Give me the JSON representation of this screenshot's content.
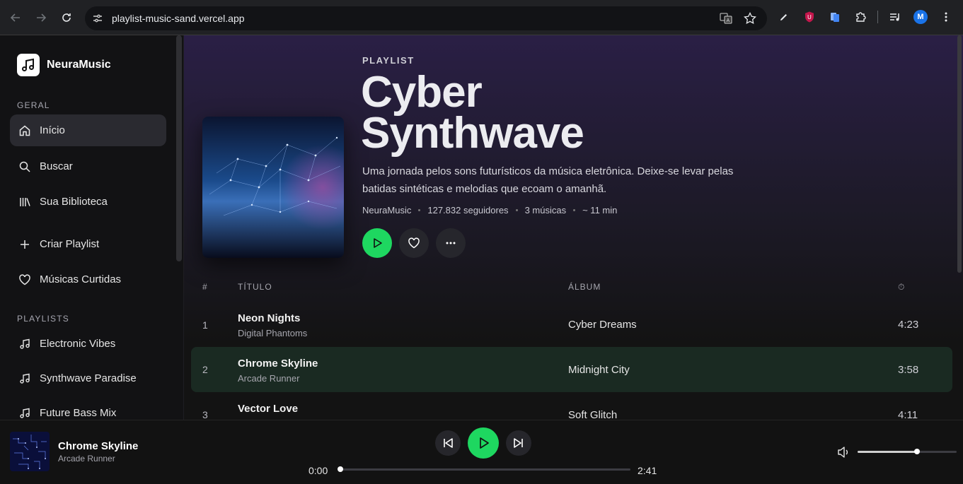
{
  "browser": {
    "url": "playlist-music-sand.vercel.app",
    "profile_initial": "M"
  },
  "sidebar": {
    "brand": "NeuraMusic",
    "section_general": "GERAL",
    "section_playlists": "PLAYLISTS",
    "items": [
      {
        "label": "Início",
        "icon": "home-icon",
        "active": true
      },
      {
        "label": "Buscar",
        "icon": "search-icon"
      },
      {
        "label": "Sua Biblioteca",
        "icon": "library-icon"
      },
      {
        "label": "Criar Playlist",
        "icon": "plus-icon"
      },
      {
        "label": "Músicas Curtidas",
        "icon": "heart-icon"
      }
    ],
    "playlists": [
      {
        "label": "Electronic Vibes",
        "icon": "music-note-icon"
      },
      {
        "label": "Synthwave Paradise",
        "icon": "music-note-icon"
      },
      {
        "label": "Future Bass Mix",
        "icon": "music-note-icon"
      }
    ]
  },
  "playlist": {
    "kicker": "PLAYLIST",
    "title": "Cyber Synthwave",
    "description": "Uma jornada pelos sons futurísticos da música eletrônica. Deixe-se levar pelas batidas sintéticas e melodias que ecoam o amanhã.",
    "owner": "NeuraMusic",
    "followers": "127.832 seguidores",
    "tracks_count": "3 músicas",
    "duration": "~ 11 min"
  },
  "table": {
    "col_num": "#",
    "col_title": "TÍTULO",
    "col_album": "ÁLBUM",
    "col_duration": "⏱",
    "rows": [
      {
        "num": "1",
        "title": "Neon Nights",
        "artist": "Digital Phantoms",
        "album": "Cyber Dreams",
        "duration": "4:23"
      },
      {
        "num": "2",
        "title": "Chrome Skyline",
        "artist": "Arcade Runner",
        "album": "Midnight City",
        "duration": "3:58",
        "active": true
      },
      {
        "num": "3",
        "title": "Vector Love",
        "artist": "",
        "album": "Soft Glitch",
        "duration": "4:11"
      }
    ]
  },
  "player": {
    "title": "Chrome Skyline",
    "artist": "Arcade Runner",
    "current_time": "0:00",
    "total_time": "2:41",
    "progress": 0.0,
    "volume": 0.6
  },
  "colors": {
    "accent": "#1ed760",
    "active_row": "#1a2a22"
  }
}
